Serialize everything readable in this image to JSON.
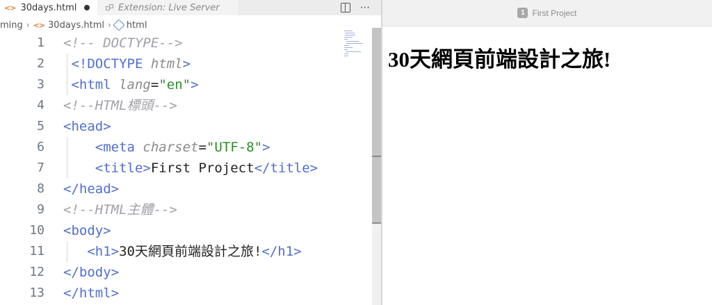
{
  "tabs": [
    {
      "label": "30days.html",
      "icon": "html-file-icon",
      "active": true,
      "dirty": true
    },
    {
      "label": "Extension: Live Server",
      "icon": "preview-icon",
      "active": false
    }
  ],
  "breadcrumb": {
    "folder": "ming",
    "file": "30days.html",
    "symbol": "html"
  },
  "code_lines": [
    {
      "num": "1",
      "parts": [
        [
          "cm",
          "<!-- DOCTYPE-->"
        ]
      ]
    },
    {
      "num": "2",
      "parts": [
        [
          "tx",
          " "
        ],
        [
          "tag",
          "<!DOCTYPE "
        ],
        [
          "attr",
          "html"
        ],
        [
          "tag",
          ">"
        ]
      ]
    },
    {
      "num": "3",
      "parts": [
        [
          "tx",
          " "
        ],
        [
          "tag",
          "<html "
        ],
        [
          "attr",
          "lang"
        ],
        [
          "tx",
          "="
        ],
        [
          "str",
          "\"en\""
        ],
        [
          "tag",
          ">"
        ]
      ]
    },
    {
      "num": "4",
      "parts": [
        [
          "cm",
          "<!--HTML標頭-->"
        ]
      ]
    },
    {
      "num": "5",
      "parts": [
        [
          "tag",
          "<head>"
        ]
      ]
    },
    {
      "num": "6",
      "parts": [
        [
          "tx",
          "    "
        ],
        [
          "tag",
          "<meta "
        ],
        [
          "attr",
          "charset"
        ],
        [
          "tx",
          "="
        ],
        [
          "str",
          "\"UTF-8\""
        ],
        [
          "tag",
          ">"
        ]
      ]
    },
    {
      "num": "7",
      "parts": [
        [
          "tx",
          "    "
        ],
        [
          "tag",
          "<title>"
        ],
        [
          "tx",
          "First Project"
        ],
        [
          "tag",
          "</title>"
        ]
      ]
    },
    {
      "num": "8",
      "parts": [
        [
          "tag",
          "</head>"
        ]
      ]
    },
    {
      "num": "9",
      "parts": [
        [
          "cm",
          "<!--HTML主體-->"
        ]
      ]
    },
    {
      "num": "10",
      "parts": [
        [
          "tag",
          "<body>"
        ]
      ]
    },
    {
      "num": "11",
      "parts": [
        [
          "tx",
          "   "
        ],
        [
          "tag",
          "<h1>"
        ],
        [
          "tx",
          "30天網頁前端設計之旅!"
        ],
        [
          "tag",
          "</h1>"
        ]
      ]
    },
    {
      "num": "12",
      "parts": [
        [
          "tag",
          "</body>"
        ]
      ]
    },
    {
      "num": "13",
      "parts": [
        [
          "tag",
          "</html>"
        ]
      ]
    }
  ],
  "browser": {
    "tab_badge": "1",
    "page_title": "First Project",
    "heading": "30天網頁前端設計之旅!"
  },
  "colors": {
    "tag": "#4f6fcf",
    "string": "#2e8a2e",
    "comment": "#a0a1a7",
    "attribute": "#8a8a8a",
    "html_icon": "#e37933"
  }
}
